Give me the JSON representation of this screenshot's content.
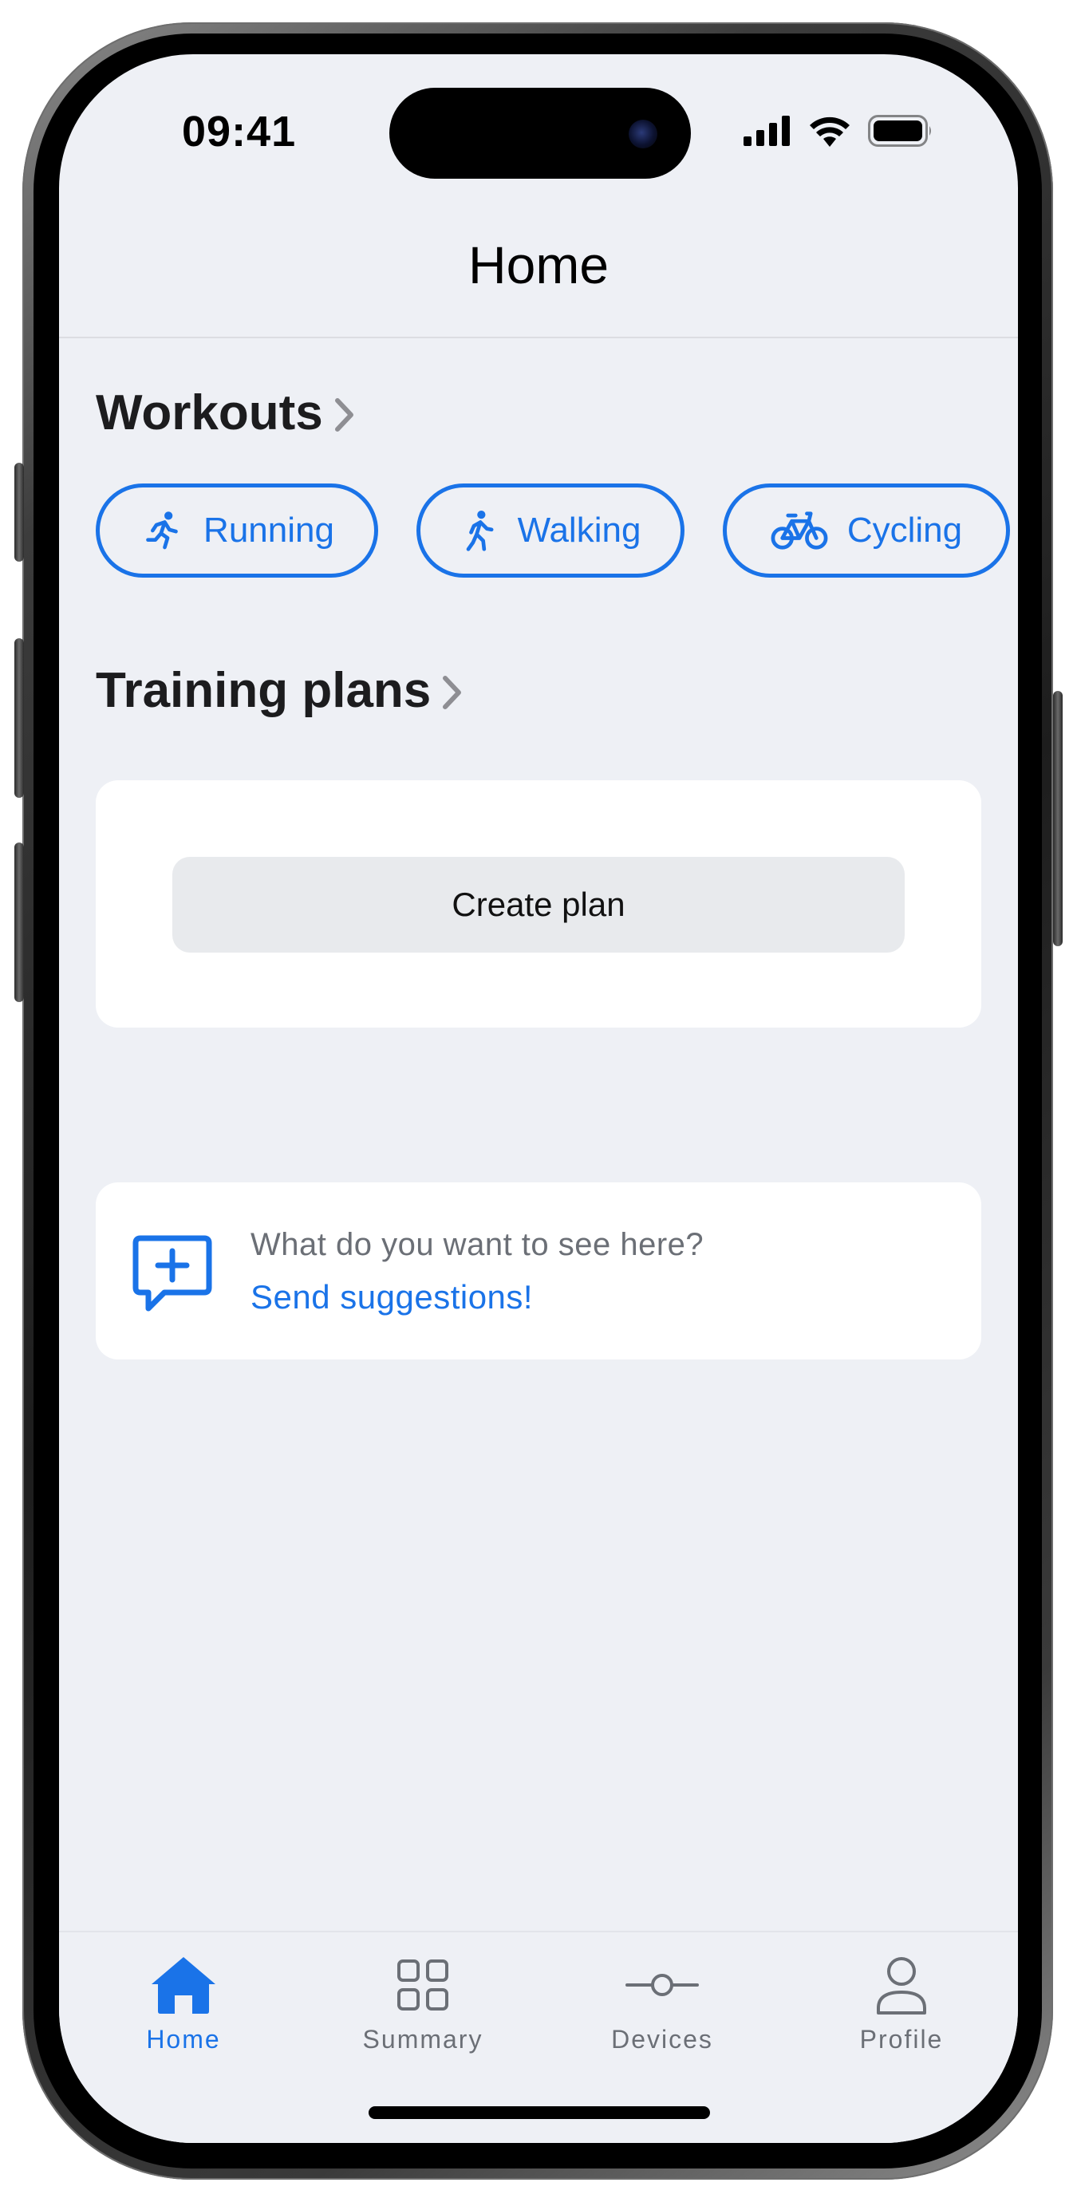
{
  "status_bar": {
    "time": "09:41"
  },
  "nav": {
    "title": "Home"
  },
  "workouts": {
    "title": "Workouts",
    "chips": [
      {
        "label": "Running",
        "icon": "running-icon"
      },
      {
        "label": "Walking",
        "icon": "walking-icon"
      },
      {
        "label": "Cycling",
        "icon": "cycling-icon"
      }
    ]
  },
  "training_plans": {
    "title": "Training plans",
    "create_button": "Create plan"
  },
  "suggestions": {
    "question": "What do you want to see here?",
    "link": "Send suggestions!",
    "icon": "chat-plus-icon"
  },
  "tab_bar": {
    "active": "Home",
    "tabs": [
      {
        "label": "Home",
        "icon": "home-icon"
      },
      {
        "label": "Summary",
        "icon": "grid-icon"
      },
      {
        "label": "Devices",
        "icon": "devices-icon"
      },
      {
        "label": "Profile",
        "icon": "person-icon"
      }
    ]
  },
  "colors": {
    "accent": "#1A73E8",
    "background": "#EEF0F5",
    "card": "#FFFFFF",
    "button_fill": "#E8EAED",
    "secondary_text": "#6B6F76"
  }
}
